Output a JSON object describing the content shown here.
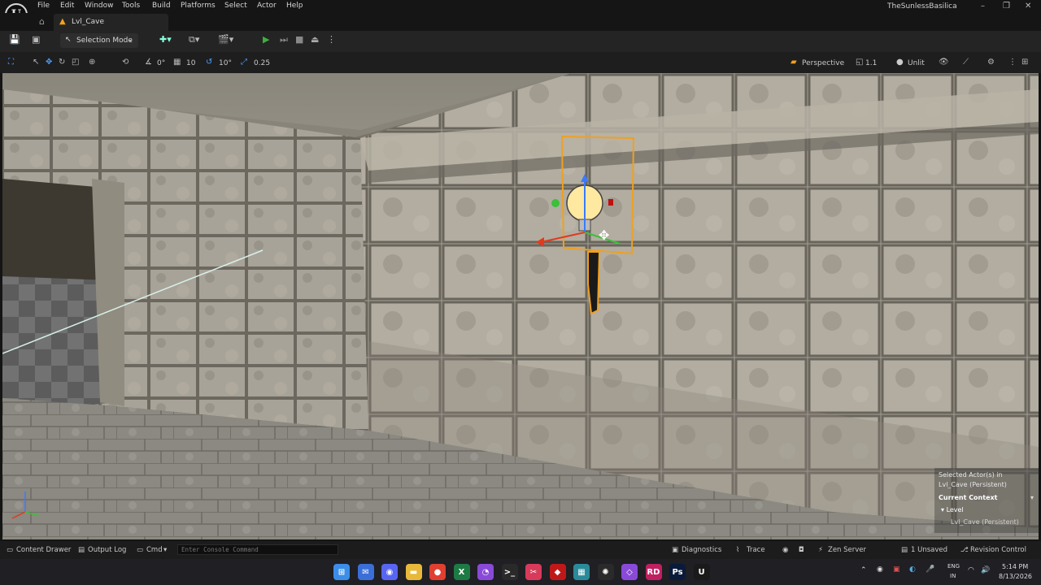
{
  "app": {
    "logo_letter": "U",
    "project_name": "TheSunlessBasilica",
    "menu": [
      "File",
      "Window",
      "Tools",
      "Build",
      "Platforms",
      "Select",
      "Actor",
      "Help"
    ],
    "window_controls": {
      "minimize": "–",
      "restore": "❐",
      "close": "✕"
    }
  },
  "tab": {
    "label": "Lvl_Cave",
    "icon": "level-icon"
  },
  "toolbar": {
    "selection_mode_label": "Selection Mode",
    "play_icon": "▶",
    "colors": {
      "play": "#3fae3f",
      "accent": "#f0a020"
    }
  },
  "viewport_toolbar": {
    "rotation_snap": "0°",
    "grid_snap": "10",
    "angle_snap": "10°",
    "scale_snap": "0.25",
    "view_mode": "Perspective",
    "fov": "1.1",
    "lighting_mode": "Unlit"
  },
  "viewport_overlay": {
    "selected_actor_line1": "Selected Actor(s) in",
    "selected_actor_line2": "Lvl_Cave (Persistent)",
    "current_context_label": "Current Context",
    "level_label": "Level",
    "level_value": "Lvl_Cave (Persistent)"
  },
  "bottombar": {
    "content_drawer": "Content Drawer",
    "output_log": "Output Log",
    "cmd": "Cmd",
    "console_placeholder": "Enter Console Command",
    "diagnostics": "Diagnostics",
    "trace": "Trace",
    "zen_server": "Zen Server",
    "unsaved": "1 Unsaved",
    "revision_control": "Revision Control"
  },
  "taskbar": {
    "lang_line1": "ENG",
    "lang_line2": "IN",
    "time": "5:14 PM",
    "date": "8/13/2026",
    "apps": [
      {
        "name": "windows-start-icon",
        "glyph": "⊞",
        "color": "#3b8ee8"
      },
      {
        "name": "mail-icon",
        "glyph": "✉",
        "color": "#3b6fd8"
      },
      {
        "name": "discord-icon",
        "glyph": "◉",
        "color": "#5865f2"
      },
      {
        "name": "file-explorer-icon",
        "glyph": "▬",
        "color": "#e8b83a"
      },
      {
        "name": "chrome-icon",
        "glyph": "●",
        "color": "#e04030"
      },
      {
        "name": "excel-icon",
        "glyph": "X",
        "color": "#1d7a43"
      },
      {
        "name": "github-icon",
        "glyph": "◔",
        "color": "#8a4ad8"
      },
      {
        "name": "terminal-icon",
        "glyph": ">_",
        "color": "#2a2a2a"
      },
      {
        "name": "snip-icon",
        "glyph": "✂",
        "color": "#d83a5a"
      },
      {
        "name": "red-app-icon",
        "glyph": "◆",
        "color": "#c01818"
      },
      {
        "name": "calculator-icon",
        "glyph": "▦",
        "color": "#2a8a9a"
      },
      {
        "name": "chatgpt-icon",
        "glyph": "✺",
        "color": "#2a2a2a"
      },
      {
        "name": "visual-studio-icon",
        "glyph": "◇",
        "color": "#8a4ad8"
      },
      {
        "name": "rider-icon",
        "glyph": "RD",
        "color": "#c02060"
      },
      {
        "name": "photoshop-icon",
        "glyph": "Ps",
        "color": "#0a1a3a"
      },
      {
        "name": "unreal-icon",
        "glyph": "U",
        "color": "#1a1a1a"
      }
    ]
  }
}
